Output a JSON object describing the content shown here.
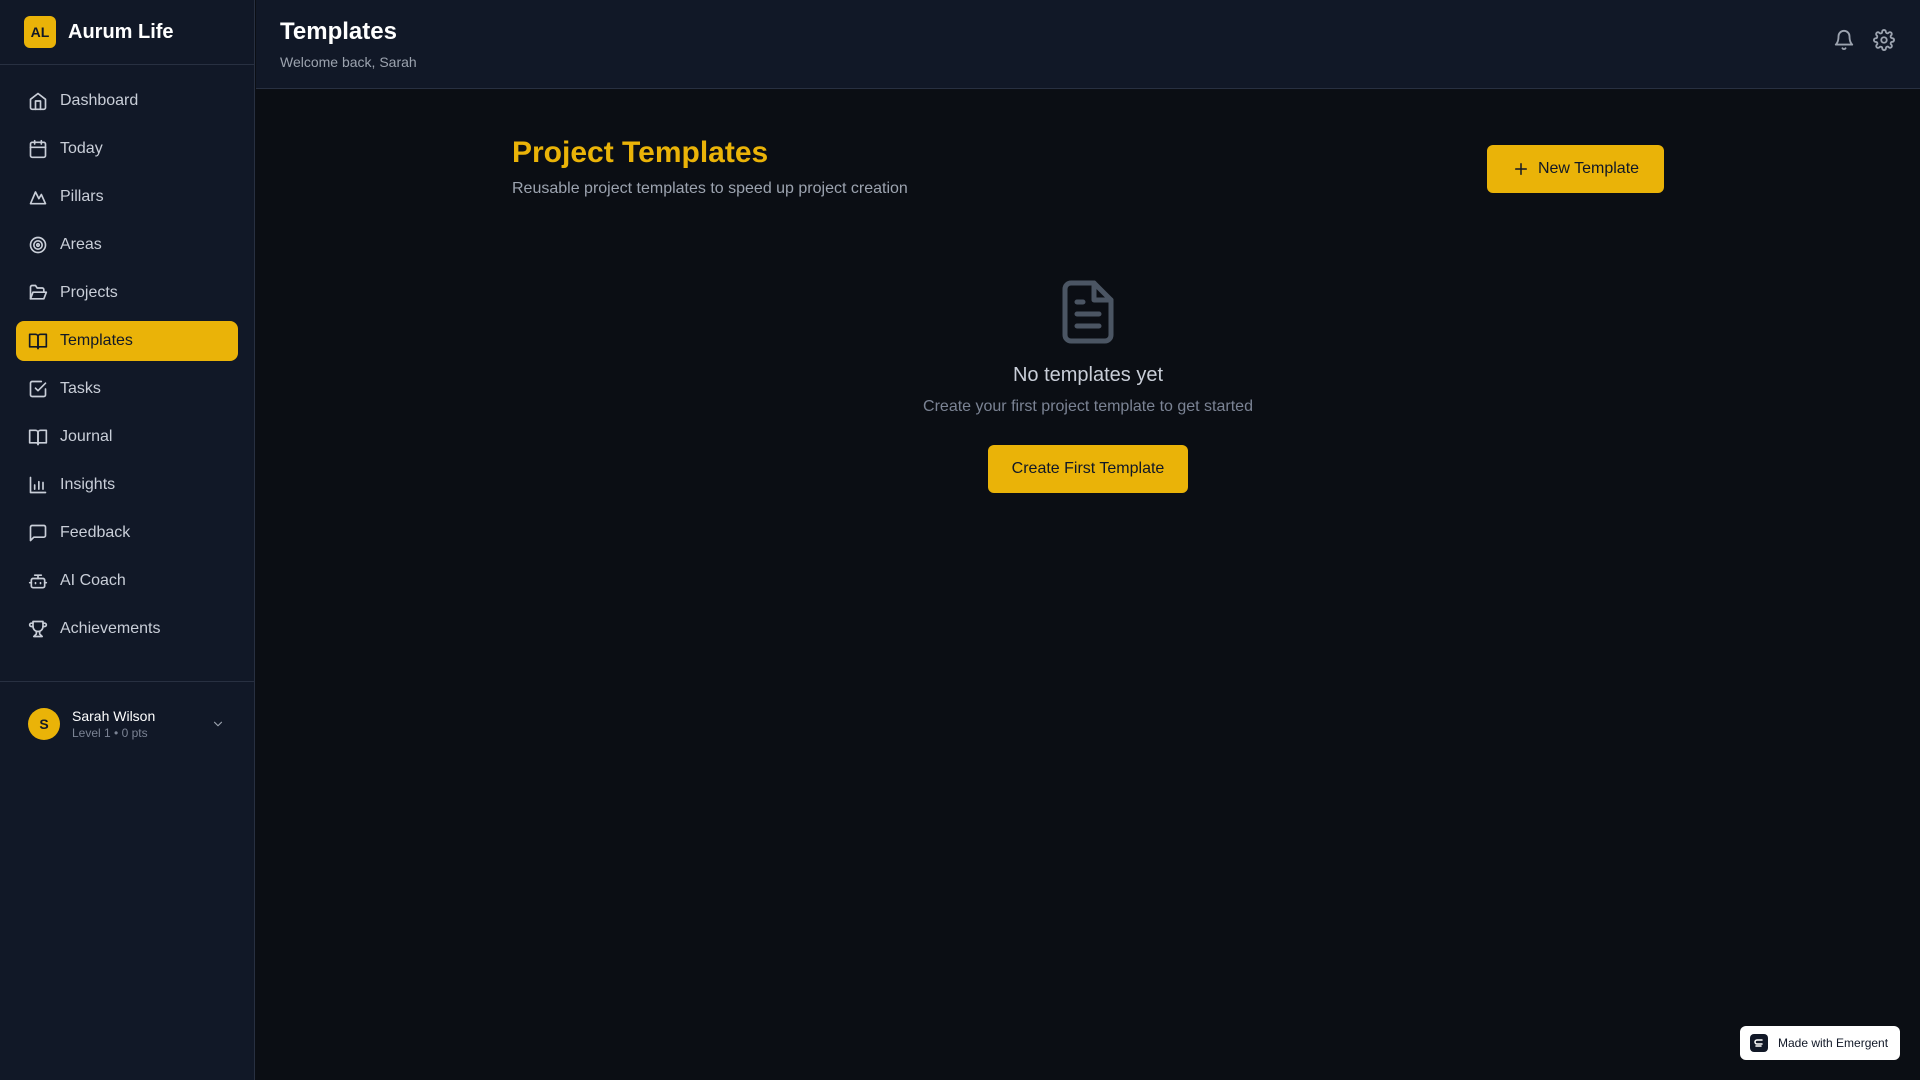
{
  "brand": {
    "logo_text": "AL",
    "name": "Aurum Life"
  },
  "sidebar": {
    "items": [
      {
        "label": "Dashboard",
        "icon": "home-icon"
      },
      {
        "label": "Today",
        "icon": "calendar-icon"
      },
      {
        "label": "Pillars",
        "icon": "mountain-icon"
      },
      {
        "label": "Areas",
        "icon": "target-icon"
      },
      {
        "label": "Projects",
        "icon": "folder-open-icon"
      },
      {
        "label": "Templates",
        "icon": "book-open-icon",
        "active": true
      },
      {
        "label": "Tasks",
        "icon": "check-square-icon"
      },
      {
        "label": "Journal",
        "icon": "book-open-icon"
      },
      {
        "label": "Insights",
        "icon": "bar-chart-icon"
      },
      {
        "label": "Feedback",
        "icon": "message-square-icon"
      },
      {
        "label": "AI Coach",
        "icon": "bot-icon"
      },
      {
        "label": "Achievements",
        "icon": "trophy-icon"
      }
    ]
  },
  "user": {
    "initial": "S",
    "name": "Sarah Wilson",
    "level": "Level 1 • 0 pts"
  },
  "header": {
    "title": "Templates",
    "welcome": "Welcome back, Sarah"
  },
  "main": {
    "title": "Project Templates",
    "subtitle": "Reusable project templates to speed up project creation",
    "new_template_label": "New Template",
    "empty_title": "No templates yet",
    "empty_desc": "Create your first project template to get started",
    "create_first_label": "Create First Template"
  },
  "badge": {
    "label": "Made with Emergent"
  },
  "colors": {
    "accent": "#eab308",
    "sidebar_bg": "#111827",
    "main_bg": "#0b0e14"
  }
}
